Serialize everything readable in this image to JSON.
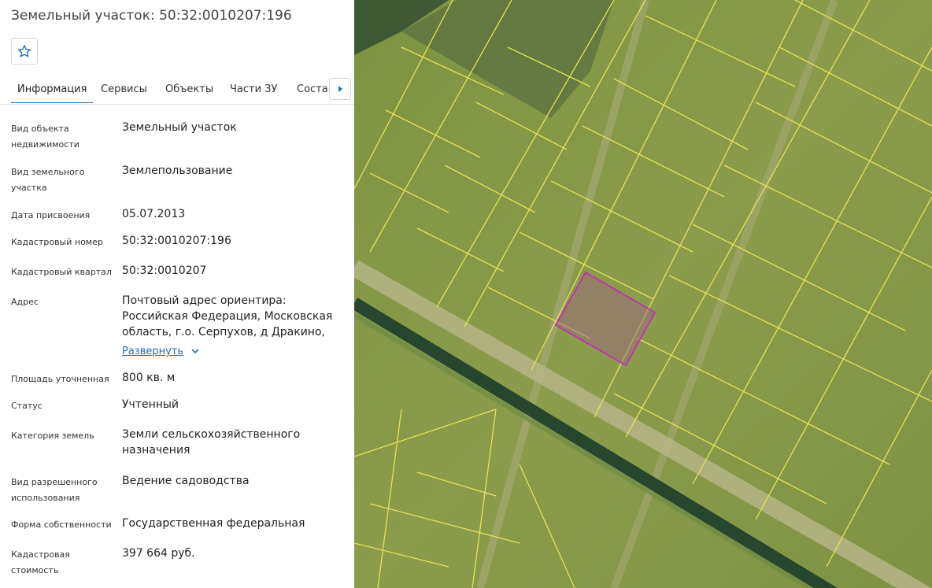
{
  "header": {
    "title": "Земельный участок: 50:32:0010207:196"
  },
  "tabs": [
    {
      "label": "Информация"
    },
    {
      "label": "Сервисы"
    },
    {
      "label": "Объекты"
    },
    {
      "label": "Части ЗУ"
    },
    {
      "label": "Состав"
    }
  ],
  "info": {
    "object_type_label": "Вид объекта недвижимости",
    "object_type_value": "Земельный участок",
    "land_type_label": "Вид земельного участка",
    "land_type_value": "Землепользование",
    "date_label": "Дата присвоения",
    "date_value": "05.07.2013",
    "cad_number_label": "Кадастровый номер",
    "cad_number_value": "50:32:0010207:196",
    "cad_quarter_label": "Кадастровый квартал",
    "cad_quarter_value": "50:32:0010207",
    "address_label": "Адрес",
    "address_value": "Почтовый адрес ориентира: Российская Федерация, Московская область, г.о. Серпухов, д Дракино,",
    "address_expand": "Развернуть",
    "area_label": "Площадь уточненная",
    "area_value": "800 кв. м",
    "status_label": "Статус",
    "status_value": "Учтенный",
    "category_label": "Категория земель",
    "category_value": "Земли сельскохозяйственного назначения",
    "permitted_use_label": "Вид разрешенного использования",
    "permitted_use_value": "Ведение садоводства",
    "ownership_label": "Форма собственности",
    "ownership_value": "Государственная федеральная",
    "cad_value_label": "Кадастровая стоимость",
    "cad_value_value": "397 664 руб."
  },
  "colors": {
    "accent": "#1d6fb8",
    "parcel_lines": "#e8e05a",
    "selected_parcel": "#c02fb8",
    "field": "#8a9a4a"
  },
  "icons": {
    "favorite": "star-icon",
    "tabs_scroll": "chevron-right-icon",
    "expand": "chevron-down-icon"
  }
}
